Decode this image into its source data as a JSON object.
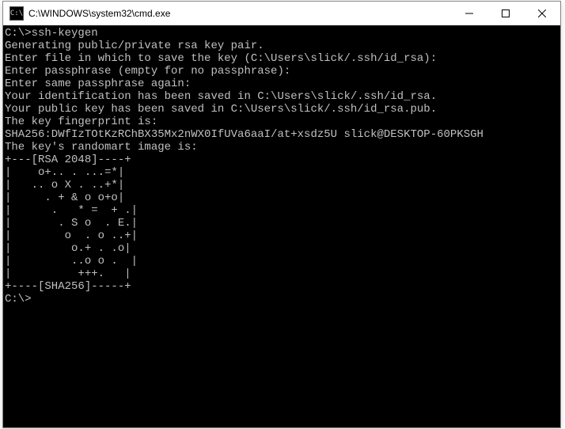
{
  "window": {
    "icon_text": "C:\\",
    "title": "C:\\WINDOWS\\system32\\cmd.exe"
  },
  "terminal": {
    "lines": [
      "",
      "C:\\>ssh-keygen",
      "Generating public/private rsa key pair.",
      "Enter file in which to save the key (C:\\Users\\slick/.ssh/id_rsa):",
      "Enter passphrase (empty for no passphrase):",
      "Enter same passphrase again:",
      "Your identification has been saved in C:\\Users\\slick/.ssh/id_rsa.",
      "Your public key has been saved in C:\\Users\\slick/.ssh/id_rsa.pub.",
      "The key fingerprint is:",
      "SHA256:DWfIzTOtKzRChBX35Mx2nWX0IfUVa6aaI/at+xsdz5U slick@DESKTOP-60PKSGH",
      "The key's randomart image is:",
      "+---[RSA 2048]----+",
      "|    o+.. . ...=*|",
      "|   .. o X . ..+*|",
      "|     . + & o o+o|",
      "|      .   * =  + .|",
      "|       . S o  . E.|",
      "|        o  . o ..+|",
      "|         o.+ . .o|",
      "|         ..o o .  |",
      "|          +++.   |",
      "+----[SHA256]-----+",
      "",
      "C:\\>"
    ]
  }
}
